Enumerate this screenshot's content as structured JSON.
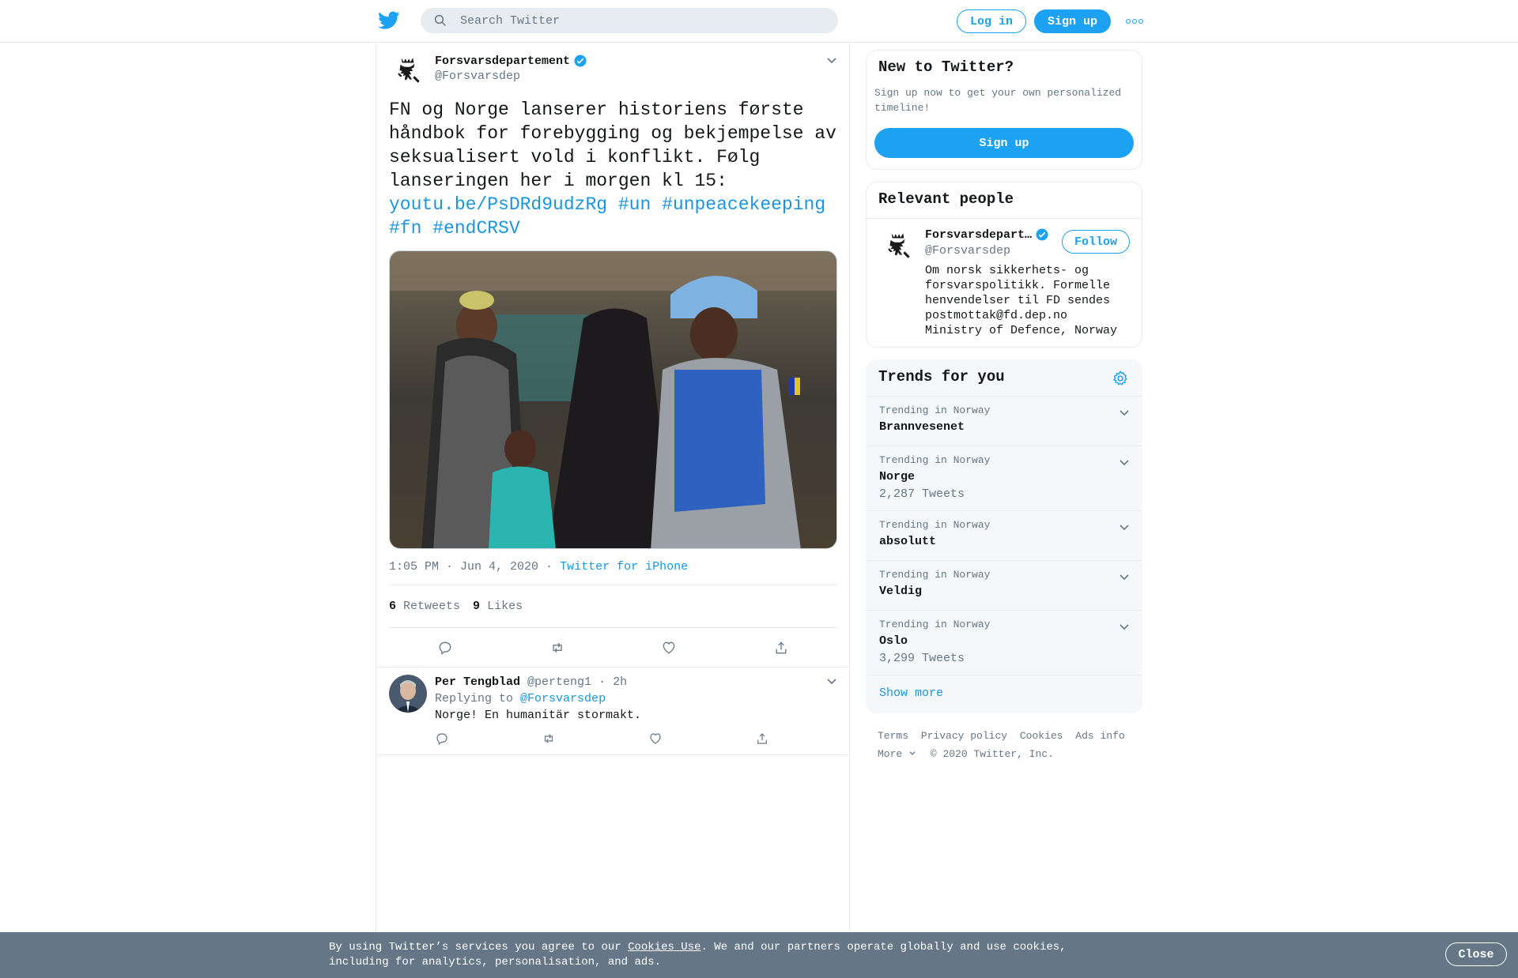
{
  "header": {
    "search_placeholder": "Search Twitter",
    "login_label": "Log in",
    "signup_label": "Sign up",
    "more_icon": "more-icon",
    "brand_color": "#1da1f2"
  },
  "tweet": {
    "author_name": "Forsvarsdepartement",
    "author_handle": "@Forsvarsdep",
    "text": "FN og Norge lanserer historiens første håndbok for forebygging og bekjempelse av seksualisert vold i konflikt. Følg lanseringen her i morgen kl 15:",
    "link": "youtu.be/PsDRd9udzRg",
    "hashtags": [
      "#un",
      "#unpeacekeeping",
      "#fn",
      "#endCRSV"
    ],
    "time": "1:05 PM · Jun 4, 2020",
    "separator": "·",
    "source": "Twitter for iPhone",
    "retweets_count": "6",
    "retweets_label": "Retweets",
    "likes_count": "9",
    "likes_label": "Likes"
  },
  "reply": {
    "name": "Per Tengblad",
    "handle": "@perteng1",
    "time": "· 2h",
    "replying_label": "Replying to",
    "replying_to": "@Forsvarsdep",
    "text": "Norge! En humanitär stormakt."
  },
  "signup_card": {
    "title": "New to Twitter?",
    "text": "Sign up now to get your own personalized timeline!",
    "button": "Sign up"
  },
  "relevant": {
    "title": "Relevant people",
    "name": "Forsvarsdepart…",
    "handle": "@Forsvarsdep",
    "follow": "Follow",
    "bio": "Om norsk sikkerhets- og forsvarspolitikk. Formelle henvendelser til FD sendes postmottak@fd.dep.no Ministry of Defence, Norway"
  },
  "trends": {
    "title": "Trends for you",
    "items": [
      {
        "context": "Trending in Norway",
        "name": "Brannvesenet",
        "count": ""
      },
      {
        "context": "Trending in Norway",
        "name": "Norge",
        "count": "2,287 Tweets"
      },
      {
        "context": "Trending in Norway",
        "name": "absolutt",
        "count": ""
      },
      {
        "context": "Trending in Norway",
        "name": "Veldig",
        "count": ""
      },
      {
        "context": "Trending in Norway",
        "name": "Oslo",
        "count": "3,299 Tweets"
      }
    ],
    "show_more": "Show more"
  },
  "footer": {
    "links": [
      "Terms",
      "Privacy policy",
      "Cookies",
      "Ads info"
    ],
    "more": "More",
    "copyright": "© 2020 Twitter, Inc."
  },
  "cookie": {
    "pre": "By using Twitter’s services you agree to our ",
    "link": "Cookies Use",
    "post": ". We and our partners operate globally and use cookies, including for analytics, personalisation, and ads.",
    "close": "Close"
  }
}
